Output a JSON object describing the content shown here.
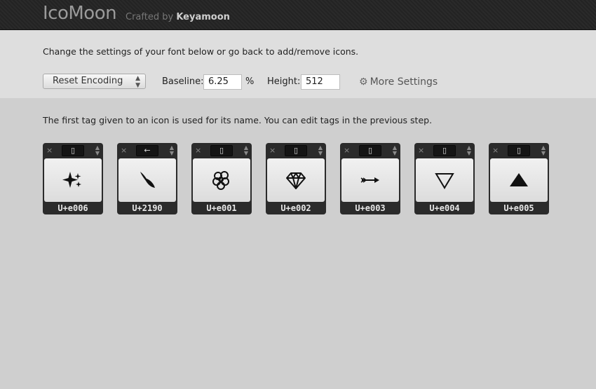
{
  "header": {
    "logo": "IcoMoon",
    "tagline_prefix": "Crafted by",
    "tagline_author": "Keyamoon"
  },
  "settings": {
    "intro": "Change the settings of your font below or go back to add/remove icons.",
    "reset_label": "Reset Encoding",
    "baseline_label": "Baseline:",
    "baseline_value": "6.25",
    "baseline_unit": "%",
    "height_label": "Height:",
    "height_value": "512",
    "more_settings_label": "More Settings"
  },
  "note": "The first tag given to an icon is used for its name. You can edit tags in the previous step.",
  "icons": [
    {
      "code": "U+e006",
      "icon": "sparkles-icon",
      "glyph": "▯"
    },
    {
      "code": "U+2190",
      "icon": "feather-icon",
      "glyph": "←"
    },
    {
      "code": "U+e001",
      "icon": "brain-icon",
      "glyph": "▯"
    },
    {
      "code": "U+e002",
      "icon": "diamond-icon",
      "glyph": "▯"
    },
    {
      "code": "U+e003",
      "icon": "arrow-right-icon",
      "glyph": "▯"
    },
    {
      "code": "U+e004",
      "icon": "triangle-down-outline-icon",
      "glyph": "▯"
    },
    {
      "code": "U+e005",
      "icon": "triangle-up-filled-icon",
      "glyph": "▯"
    }
  ],
  "card_controls": {
    "remove": "×",
    "stepper": "⌃⌄"
  }
}
